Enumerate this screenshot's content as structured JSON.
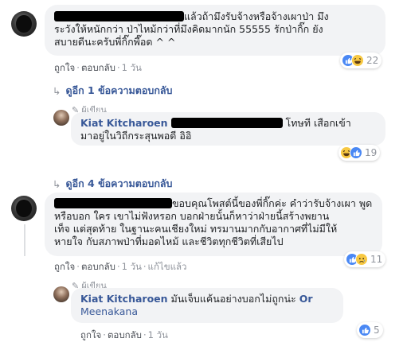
{
  "comment1": {
    "text": "แล้วถ้ามึงรับจ้างหรือจ้างเผาป่า มึงระวังให้หนักกว่า ป่าไหม้กว่าที่มึงคิดมากนัก 55555 รักป่ากิ๊ก ยังสบายดีนะครับพี่กิ๊กพี๊อด ^ ^",
    "line1": "แล้วถ้ามึงรับจ้างหรือจ้างเผาป่า มึง",
    "line2": "ระวังให้หนักกว่า ป่าไหม้กว่าที่มึงคิดมากนัก 55555 รักป่ากิ๊ก ยัง",
    "line3": "สบายดีนะครับพี่กิ๊กพี๊อด ^ ^",
    "like": "ถูกใจ",
    "reply": "ตอบกลับ",
    "time": "1 วัน",
    "reaction_count": "22",
    "reaction_icons": [
      "like-icon",
      "haha-icon"
    ],
    "view_replies": "ดูอีก 1 ข้อความตอบกลับ"
  },
  "reply1": {
    "author_tag": "ผู้เขียน",
    "name": "Kiat Kitcharoen",
    "line1_after": "โทษที เสือกเข้า",
    "line2": "มาอยู่ในวิถีกระสุนพอดี อิอิ",
    "reaction_count": "19",
    "reaction_icons": [
      "haha-icon",
      "like-icon"
    ]
  },
  "view_replies_2": "ดูอีก 4 ข้อความตอบกลับ",
  "comment2": {
    "line1": "ขอบคุณโพสต์นี้ของพี่กิ๊กค่ะ คำว่ารับจ้างเผา พูด",
    "line2": "หรือบอก ใคร เขาไม่ฟังหรอก บอกฝ่ายนั้นก็หาว่าฝ่ายนี้สร้างพยาน",
    "line3": "เท็จ แต่สุดท้าย ในฐานะคนเชียงใหม่ ทรมานมากกับอากาศที่ไม่มีให้",
    "line4": "หายใจ กับสภาพป่าที่มอดไหม้ และชีวิตทุกชีวิตที่เสียไป",
    "like": "ถูกใจ",
    "reply": "ตอบกลับ",
    "time": "1 วัน",
    "edited": "แก้ไขแล้ว",
    "reaction_count": "11",
    "reaction_icons": [
      "like-icon",
      "sad-icon"
    ]
  },
  "reply2": {
    "author_tag": "ผู้เขียน",
    "name": "Kiat Kitcharoen",
    "line1_after": "มันเจ็บแค้นอย่างบอกไม่ถูกน่ะ",
    "mention_part1": "Or",
    "mention_part2": "Meenakana",
    "like": "ถูกใจ",
    "reply": "ตอบกลับ",
    "time": "1 วัน",
    "reaction_count": "5",
    "reaction_icons": [
      "like-icon"
    ]
  },
  "colors": {
    "link": "#385898",
    "bubble": "#f2f3f5",
    "meta": "#90949c",
    "like_blue": "#4a88f4",
    "emoji_yellow": "#f7c842"
  }
}
